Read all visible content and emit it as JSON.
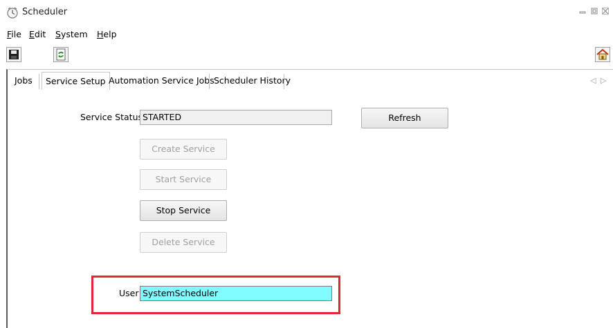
{
  "window": {
    "title": "Scheduler",
    "icons": [
      "clock-icon",
      "minimize-icon",
      "restore-icon",
      "close-icon"
    ]
  },
  "menu": {
    "file": {
      "mnemonic": "F",
      "rest": "ile"
    },
    "edit": {
      "mnemonic": "E",
      "rest": "dit"
    },
    "system": {
      "mnemonic": "S",
      "rest": "ystem"
    },
    "help": {
      "mnemonic": "H",
      "rest": "elp"
    }
  },
  "toolbar": {
    "icons": [
      "save-icon",
      "refresh-icon",
      "home-icon"
    ]
  },
  "tabs": [
    {
      "label": "Jobs"
    },
    {
      "label": "Service Setup"
    },
    {
      "label": "Automation Service Jobs"
    },
    {
      "label": "Scheduler History"
    }
  ],
  "tab_scroll": {
    "left": "◁",
    "right": "▷"
  },
  "service": {
    "status_label": "Service  Status",
    "status_value": "STARTED",
    "refresh_label": "Refresh",
    "create_label": "Create Service",
    "start_label": "Start Service",
    "stop_label": "Stop Service",
    "delete_label": "Delete Service",
    "user_label": "User",
    "user_value": "SystemScheduler"
  },
  "colors": {
    "highlight_border": "#e32636",
    "user_field_bg": "#80fbff"
  }
}
